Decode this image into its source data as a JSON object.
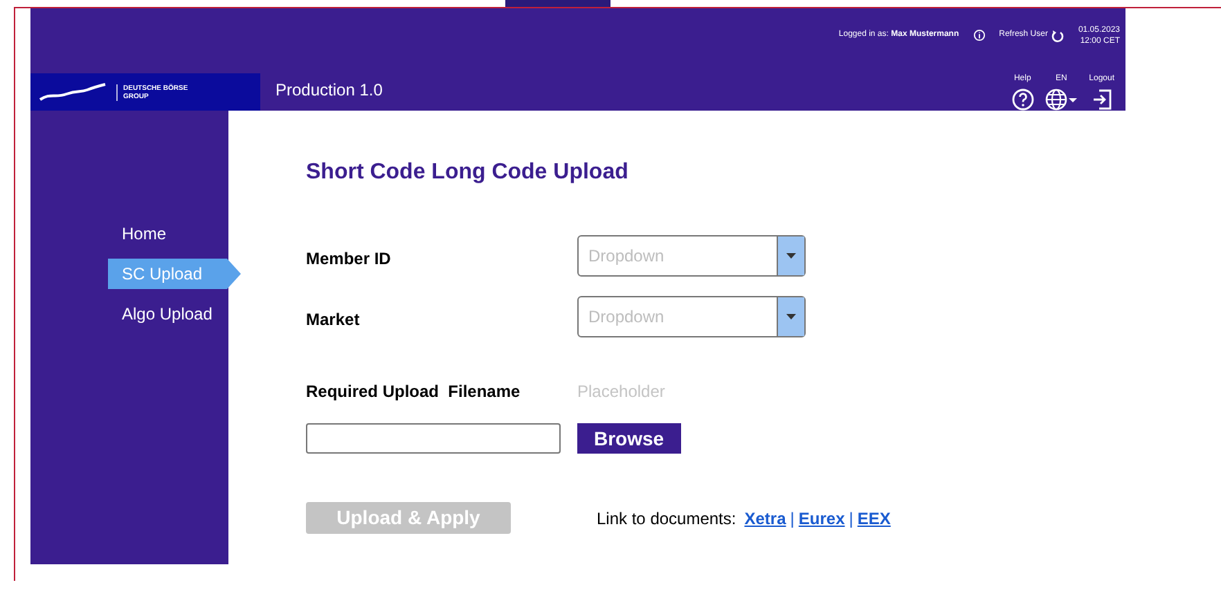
{
  "header": {
    "logged_in_label": "Logged in as:",
    "user": "Max Mustermann",
    "refresh": "Refresh User",
    "date": "01.05.2023",
    "time": "12:00 CET",
    "logo": {
      "line1": "DEUTSCHE BÖRSE",
      "line2": "GROUP"
    },
    "title": "Production 1.0",
    "actions": [
      {
        "kind": "help",
        "label": "Help"
      },
      {
        "kind": "language",
        "label": "EN"
      },
      {
        "kind": "logout",
        "label": "Logout"
      }
    ]
  },
  "sidebar": {
    "items": [
      {
        "label": "Home",
        "selected": false
      },
      {
        "label": "SC Upload",
        "selected": true
      },
      {
        "label": "Algo Upload",
        "selected": false
      }
    ]
  },
  "page_title": "Short Code Long Code Upload",
  "fields": [
    {
      "label": "Member ID",
      "placeholder": "Dropdown"
    },
    {
      "label": "Market",
      "placeholder": "Dropdown"
    }
  ],
  "upload": {
    "label": "Required Upload  Filename",
    "filename": "Placeholder",
    "browse": "Browse"
  },
  "apply_button": {
    "label": "Upload & Apply",
    "disabled": true
  },
  "documents": {
    "label": "Link to documents:",
    "links": [
      {
        "kind": "link",
        "text": "Xetra"
      },
      {
        "kind": "separator",
        "text": "|"
      },
      {
        "kind": "link",
        "text": "Eurex"
      },
      {
        "kind": "separator",
        "text": "|"
      },
      {
        "kind": "link",
        "text": "EEX"
      }
    ]
  }
}
